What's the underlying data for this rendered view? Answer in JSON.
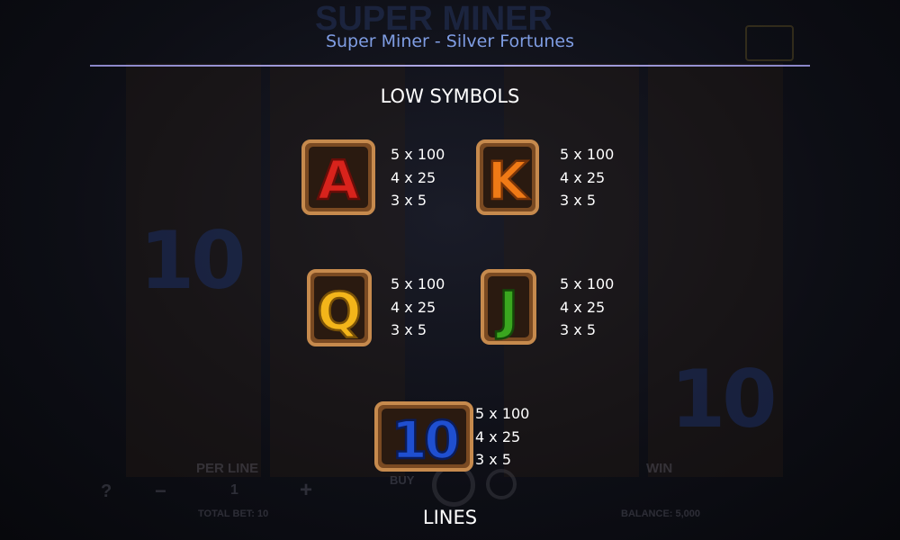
{
  "background": {
    "game_title": "SUPER MINER",
    "labels": {
      "per_line": "PER LINE",
      "win": "WIN",
      "buy": "BUY",
      "total_bet": "TOTAL BET: 10",
      "balance": "BALANCE: 5,000",
      "bet_value": "1",
      "help": "?",
      "minus": "−",
      "plus": "+"
    }
  },
  "header": {
    "title": "Super Miner - Silver Fortunes"
  },
  "sections": {
    "low_symbols": "LOW SYMBOLS",
    "lines": "LINES"
  },
  "symbols": [
    {
      "glyph": "A",
      "color": "#d8231c",
      "pays": [
        "5 x 100",
        "4 x 25",
        "3 x 5"
      ]
    },
    {
      "glyph": "K",
      "color": "#f07a16",
      "pays": [
        "5 x 100",
        "4 x 25",
        "3 x 5"
      ]
    },
    {
      "glyph": "Q",
      "color": "#f3b51a",
      "pays": [
        "5 x 100",
        "4 x 25",
        "3 x 5"
      ]
    },
    {
      "glyph": "J",
      "color": "#3aa61f",
      "pays": [
        "5 x 100",
        "4 x 25",
        "3 x 5"
      ]
    },
    {
      "glyph": "10",
      "color": "#1f4fd0",
      "pays": [
        "5 x 100",
        "4 x 25",
        "3 x 5"
      ]
    }
  ],
  "colors": {
    "title_blue": "#7f9de3",
    "divider": "#a49ddc",
    "text": "#ffffff",
    "frame_wood": "#b8753a"
  }
}
